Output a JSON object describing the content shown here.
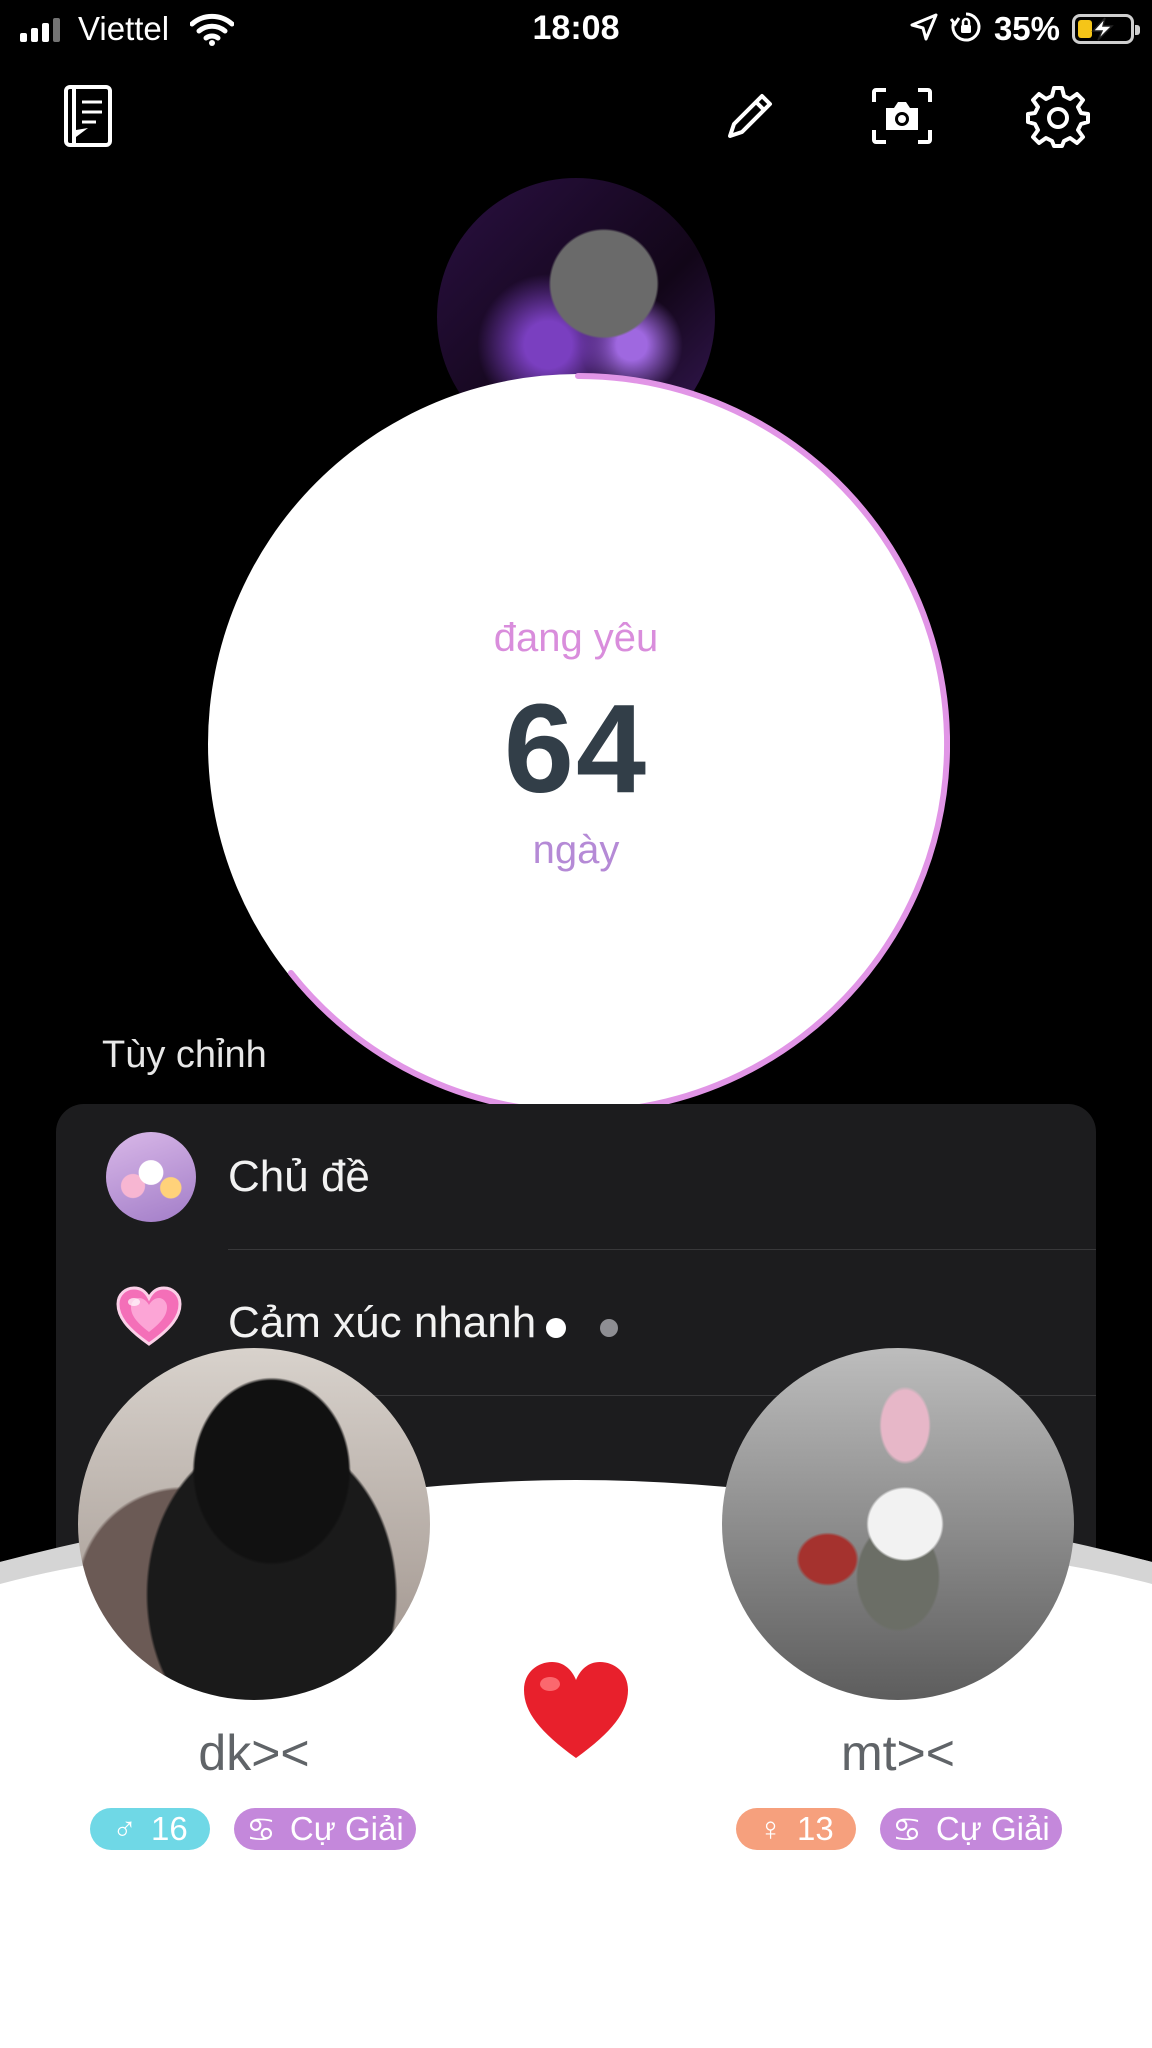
{
  "status_bar": {
    "carrier": "Viettel",
    "time": "18:08",
    "battery": "35%",
    "battery_level": 0.35,
    "icons": [
      "signal-icon",
      "wifi-icon",
      "location-arrow-icon",
      "orientation-lock-icon",
      "battery-charging-icon"
    ]
  },
  "toolbar": {
    "items": [
      "diary-book-icon",
      "pencil-icon",
      "camera-icon",
      "gear-icon"
    ]
  },
  "counter": {
    "label": "đang yêu",
    "days": "64",
    "unit": "ngày"
  },
  "customize": {
    "title": "Tùy chỉnh",
    "items": [
      {
        "label": "Chủ đề",
        "icon": "theme-thumbnail"
      },
      {
        "label": "Cảm xúc nhanh",
        "icon": "pink-heart-icon"
      }
    ]
  },
  "couple": {
    "left": {
      "name": "dk><",
      "gender_symbol": "♂",
      "age": "16",
      "zodiac_symbol": "♋",
      "zodiac": "Cự Giải",
      "age_color": "#6fd8e6",
      "zodiac_color": "#c488db"
    },
    "right": {
      "name": "mt><",
      "gender_symbol": "♀",
      "age": "13",
      "zodiac_symbol": "♋",
      "zodiac": "Cự Giải",
      "age_color": "#f6a07d",
      "zodiac_color": "#c488db"
    },
    "center_icon": "red-heart-icon"
  },
  "colors": {
    "accent_pink": "#e195e6",
    "counter_text": "#323e48",
    "unit_purple": "#b58ad6",
    "panel_bg": "#1c1c1e"
  }
}
